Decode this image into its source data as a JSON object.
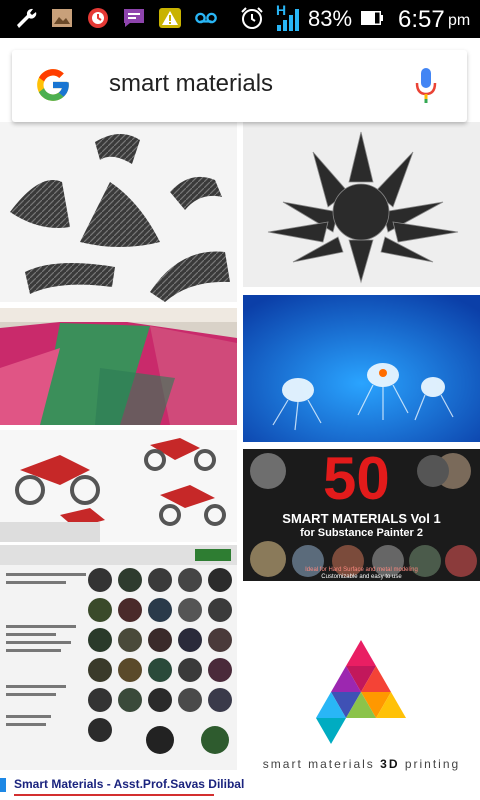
{
  "status_bar": {
    "battery_percent": "83%",
    "time": "6:57",
    "ampm": "pm",
    "network": "H",
    "icons": [
      "wrench-icon",
      "gallery-icon",
      "alarm-app-icon",
      "chat-icon",
      "warning-icon",
      "voicemail-icon",
      "alarm-clock-icon",
      "signal-icon",
      "battery-icon"
    ]
  },
  "search": {
    "query": "smart materials"
  },
  "results": [
    {
      "image": "carbon-fiber-rolls"
    },
    {
      "image": "ferrofluid-spikes"
    },
    {
      "image": "color-changing-fabric"
    },
    {
      "image": "underwater-robots"
    },
    {
      "image": "wheel-chair-concept"
    },
    {
      "image": "substance-materials-pack",
      "badge": "50",
      "title": "SMART MATERIALS Vol 1",
      "subtitle": "for Substance Painter 2",
      "note1": "Ideal for Hard Surface and metal modeling",
      "note2": "Customizable and easy to use"
    },
    {
      "image": "material-balls-sheet"
    },
    {
      "image": "smart-materials-3d-logo",
      "text_prefix": "smart materials ",
      "text_bold": "3D",
      "text_suffix": " printing"
    }
  ],
  "caption": {
    "text": "Smart Materials  -  Asst.Prof.Savas Dilibal"
  }
}
